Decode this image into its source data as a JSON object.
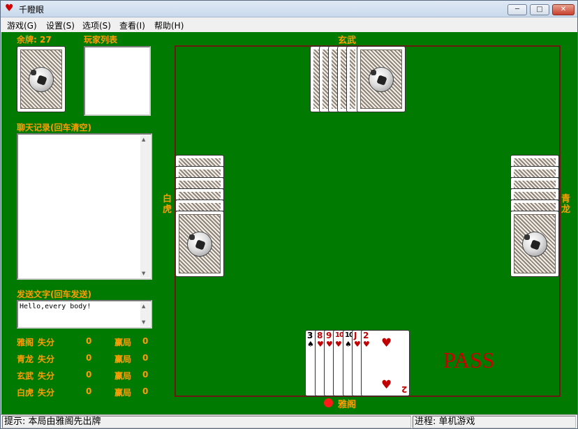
{
  "window": {
    "title": "千瞪眼",
    "min": "─",
    "max": "□",
    "close": "✕"
  },
  "menu": [
    "游戏(G)",
    "设置(S)",
    "选项(S)",
    "查看(I)",
    "帮助(H)"
  ],
  "panel": {
    "remaining_label": "余牌: 27",
    "players_label": "玩家列表",
    "chat_label": "聊天记录(回车清空)",
    "send_label": "发送文字(回车发送)",
    "send_value": "Hello,every body!"
  },
  "scores": [
    {
      "name": "雅阁",
      "lose_label": "失分",
      "lose": "0",
      "win_label": "赢局",
      "win": "0"
    },
    {
      "name": "青龙",
      "lose_label": "失分",
      "lose": "0",
      "win_label": "赢局",
      "win": "0"
    },
    {
      "name": "玄武",
      "lose_label": "失分",
      "lose": "0",
      "win_label": "赢局",
      "win": "0"
    },
    {
      "name": "白虎",
      "lose_label": "失分",
      "lose": "0",
      "win_label": "赢局",
      "win": "0"
    }
  ],
  "players": {
    "top": "玄武",
    "left": "白虎",
    "right": "青龙",
    "bottom": "雅阁"
  },
  "hand": [
    {
      "rank": "3",
      "suit": "♠",
      "color": "black"
    },
    {
      "rank": "8",
      "suit": "♥",
      "color": "red"
    },
    {
      "rank": "9",
      "suit": "♥",
      "color": "red"
    },
    {
      "rank": "10",
      "suit": "♥",
      "color": "red"
    },
    {
      "rank": "10",
      "suit": "♠",
      "color": "black"
    },
    {
      "rank": "J",
      "suit": "♥",
      "color": "red"
    },
    {
      "rank": "2",
      "suit": "♥",
      "color": "red"
    }
  ],
  "pass_text": "PASS",
  "status": {
    "hint": "提示: 本局由雅阁先出牌",
    "progress": "进程: 单机游戏"
  },
  "colors": {
    "table_green": "#007a00",
    "label_orange": "#ff9c00",
    "pass_red": "#cc0000",
    "border_brown": "#6a1a10"
  }
}
